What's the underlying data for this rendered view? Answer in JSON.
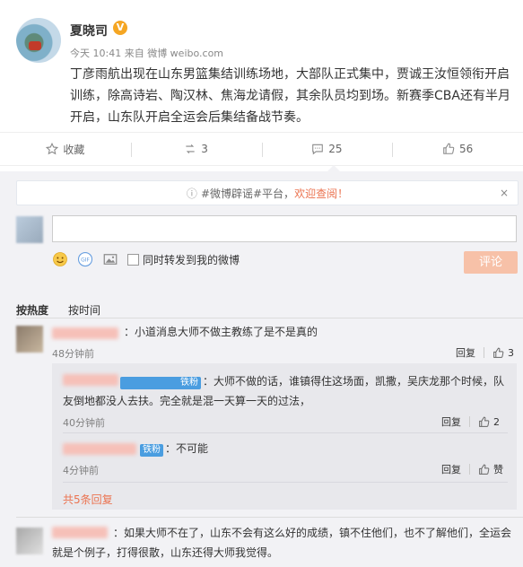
{
  "post": {
    "author": "夏晓司",
    "verified_badge": "V",
    "meta": "今天 10:41 来自 微博 weibo.com",
    "content": "丁彦雨航出现在山东男篮集结训练场地，大部队正式集中，贾诚王汝恒领衔开启训练，除高诗岩、陶汉林、焦海龙请假，其余队员均到场。新赛季CBA还有半月开启，山东队开启全运会后集结备战节奏。",
    "actions": {
      "favorite_label": "收藏",
      "repost_count": "3",
      "comment_count": "25",
      "like_count": "56"
    }
  },
  "rumor_bar": {
    "text_prefix": "#微博辟谣#平台，",
    "text_link": "欢迎查阅！",
    "close": "×"
  },
  "composer": {
    "input_value": "",
    "repost_checkbox_label": "同时转发到我的微博",
    "submit_label": "评论"
  },
  "sort_tabs": {
    "hot": "按热度",
    "time": "按时间"
  },
  "comments": [
    {
      "text": "：小道消息大师不做主教练了是不是真的",
      "time": "48分钟前",
      "reply_label": "回复",
      "like_count": "3",
      "replies": [
        {
          "badge": "铁粉",
          "text": "：大师不做的话，谁镇得住这场面，凯撒，吴庆龙那个时候，队友倒地都没人去扶。完全就是混一天算一天的过法，",
          "time": "40分钟前",
          "reply_label": "回复",
          "like_count": "2"
        },
        {
          "badge": "铁粉",
          "text": "：不可能",
          "time": "4分钟前",
          "reply_label": "回复",
          "like_count": "赞"
        }
      ],
      "more_label": "共5条回复"
    },
    {
      "text": "：如果大师不在了，山东不会有这么好的成绩，镇不住他们，也不了解他们，全运会就是个例子，打得很散，山东还得大师我觉得。"
    }
  ],
  "colors": {
    "accent": "#eb7350",
    "submit_disabled": "#f7c1a8",
    "badge_blue": "#4a9de0",
    "verified": "#f5a623"
  }
}
